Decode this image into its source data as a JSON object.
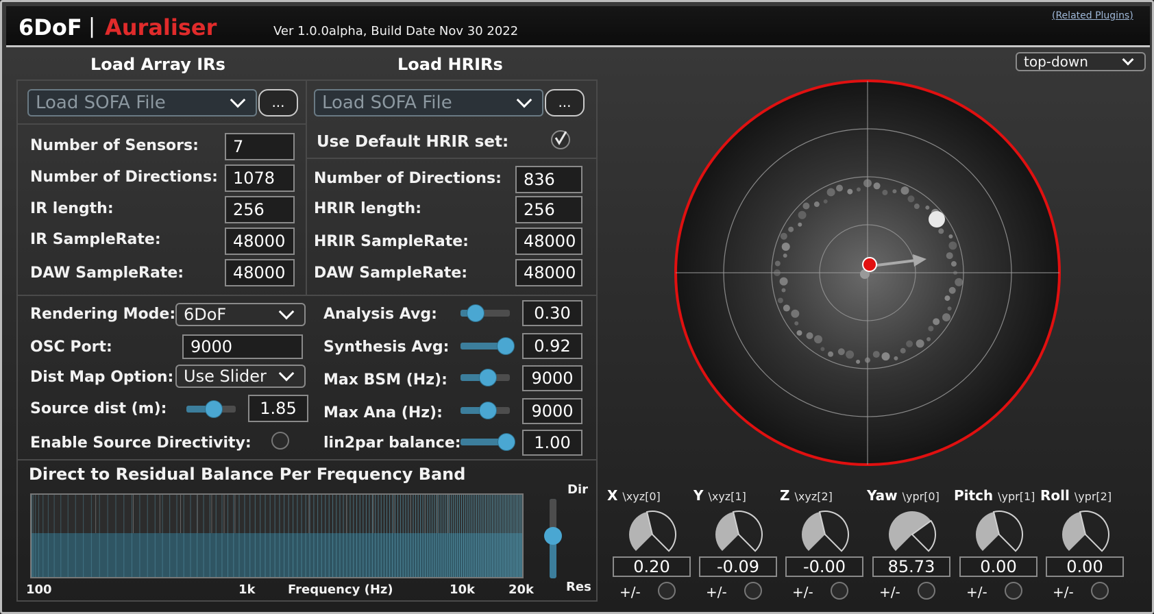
{
  "header": {
    "title_main": "6DoF",
    "separator": "|",
    "title_sub": "Auraliser",
    "version": "Ver 1.0.0alpha, Build Date Nov 30 2022",
    "related_link": "(Related Plugins)"
  },
  "array_irs": {
    "title": "Load Array IRs",
    "sofa_placeholder": "Load SOFA File",
    "browse_label": "...",
    "fields": [
      {
        "label": "Number of Sensors:",
        "value": "7"
      },
      {
        "label": "Number of Directions:",
        "value": "1078"
      },
      {
        "label": "IR length:",
        "value": "256"
      },
      {
        "label": "IR SampleRate:",
        "value": "48000"
      },
      {
        "label": "DAW SampleRate:",
        "value": "48000"
      }
    ]
  },
  "hrirs": {
    "title": "Load HRIRs",
    "sofa_placeholder": "Load SOFA File",
    "browse_label": "...",
    "default_label": "Use Default HRIR set:",
    "default_checked": true,
    "fields": [
      {
        "label": "Number of Directions:",
        "value": "836"
      },
      {
        "label": "HRIR length:",
        "value": "256"
      },
      {
        "label": "HRIR SampleRate:",
        "value": "48000"
      },
      {
        "label": "DAW SampleRate:",
        "value": "48000"
      }
    ]
  },
  "settings": {
    "rendering_mode_label": "Rendering Mode:",
    "rendering_mode_value": "6DoF",
    "osc_port_label": "OSC Port:",
    "osc_port_value": "9000",
    "dist_map_label": "Dist Map Option:",
    "dist_map_value": "Use Slider",
    "source_dist_label": "Source dist (m):",
    "source_dist_value": "1.85",
    "source_dist_fraction": 0.55,
    "directivity_label": "Enable Source Directivity:"
  },
  "params": [
    {
      "label": "Analysis Avg:",
      "value": "0.30",
      "fraction": 0.3
    },
    {
      "label": "Synthesis Avg:",
      "value": "0.92",
      "fraction": 0.92
    },
    {
      "label": "Max BSM (Hz):",
      "value": "9000",
      "fraction": 0.55
    },
    {
      "label": "Max Ana (Hz):",
      "value": "9000",
      "fraction": 0.55
    },
    {
      "label": "lin2par balance:",
      "value": "1.00",
      "fraction": 0.93
    }
  ],
  "balance": {
    "title": "Direct to Residual Balance Per Frequency Band",
    "x_label": "Frequency (Hz)",
    "ticks": [
      "100",
      "1k",
      "10k",
      "20k"
    ],
    "dir_label": "Dir",
    "res_label": "Res",
    "level_fraction": 0.5
  },
  "view": {
    "mode": "top-down"
  },
  "knobs": [
    {
      "name": "X",
      "sub": "\\xyz[0]",
      "value": "0.20",
      "pm": "+/-"
    },
    {
      "name": "Y",
      "sub": "\\xyz[1]",
      "value": "-0.09",
      "pm": "+/-"
    },
    {
      "name": "Z",
      "sub": "\\xyz[2]",
      "value": "-0.00",
      "pm": "+/-"
    },
    {
      "name": "Yaw",
      "sub": "\\ypr[0]",
      "value": "85.73",
      "pm": "+/-"
    },
    {
      "name": "Pitch",
      "sub": "\\ypr[1]",
      "value": "0.00",
      "pm": "+/-"
    },
    {
      "name": "Roll",
      "sub": "\\ypr[2]",
      "value": "0.00",
      "pm": "+/-"
    }
  ],
  "colors": {
    "accent_red": "#e02b2b",
    "slider_blue": "#4aa7d2"
  }
}
